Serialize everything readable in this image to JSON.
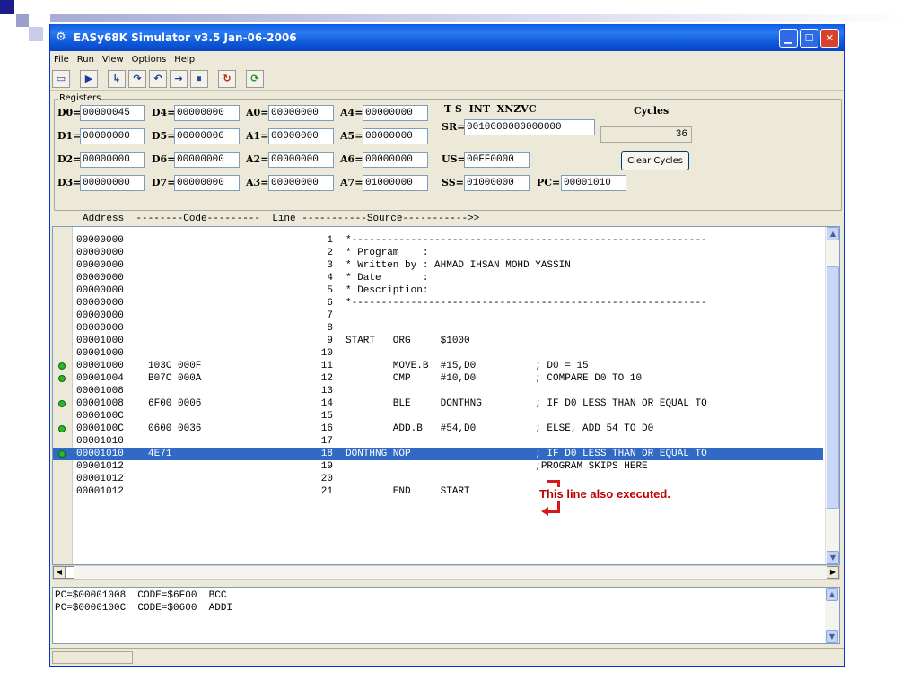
{
  "window": {
    "title": "EASy68K Simulator v3.5 Jan-06-2006"
  },
  "menu": [
    "File",
    "Run",
    "View",
    "Options",
    "Help"
  ],
  "registers": {
    "legend": "Registers",
    "D0": "00000045",
    "D1": "00000000",
    "D2": "00000000",
    "D3": "00000000",
    "D4": "00000000",
    "D5": "00000000",
    "D6": "00000000",
    "D7": "00000000",
    "A0": "00000000",
    "A1": "00000000",
    "A2": "00000000",
    "A3": "00000000",
    "A4": "00000000",
    "A5": "00000000",
    "A6": "00000000",
    "A7": "01000000",
    "status_header": "T S  INT  XNZVC",
    "SR": "0010000000000000",
    "US": "00FF0000",
    "SS": "01000000",
    "PC": "00001010",
    "cycles_label": "Cycles",
    "cycles": "36",
    "clear_cycles": "Clear Cycles"
  },
  "column_header": "Address  --------Code---------  Line -----------Source----------->>",
  "listing": [
    {
      "addr": "00000000",
      "code": "",
      "line": "1",
      "src": "*------------------------------------------------------------",
      "bp": false
    },
    {
      "addr": "00000000",
      "code": "",
      "line": "2",
      "src": "* Program    :",
      "bp": false
    },
    {
      "addr": "00000000",
      "code": "",
      "line": "3",
      "src": "* Written by : AHMAD IHSAN MOHD YASSIN",
      "bp": false
    },
    {
      "addr": "00000000",
      "code": "",
      "line": "4",
      "src": "* Date       :",
      "bp": false
    },
    {
      "addr": "00000000",
      "code": "",
      "line": "5",
      "src": "* Description:",
      "bp": false
    },
    {
      "addr": "00000000",
      "code": "",
      "line": "6",
      "src": "*------------------------------------------------------------",
      "bp": false
    },
    {
      "addr": "00000000",
      "code": "",
      "line": "7",
      "src": "",
      "bp": false
    },
    {
      "addr": "00000000",
      "code": "",
      "line": "8",
      "src": "",
      "bp": false
    },
    {
      "addr": "00001000",
      "code": "",
      "line": "9",
      "src": "START   ORG     $1000",
      "bp": false
    },
    {
      "addr": "00001000",
      "code": "",
      "line": "10",
      "src": "",
      "bp": false
    },
    {
      "addr": "00001000",
      "code": "103C 000F",
      "line": "11",
      "src": "        MOVE.B  #15,D0          ; D0 = 15",
      "bp": true
    },
    {
      "addr": "00001004",
      "code": "B07C 000A",
      "line": "12",
      "src": "        CMP     #10,D0          ; COMPARE D0 TO 10",
      "bp": true
    },
    {
      "addr": "00001008",
      "code": "",
      "line": "13",
      "src": "",
      "bp": false
    },
    {
      "addr": "00001008",
      "code": "6F00 0006",
      "line": "14",
      "src": "        BLE     DONTHNG         ; IF D0 LESS THAN OR EQUAL TO",
      "bp": true
    },
    {
      "addr": "0000100C",
      "code": "",
      "line": "15",
      "src": "",
      "bp": false
    },
    {
      "addr": "0000100C",
      "code": "0600 0036",
      "line": "16",
      "src": "        ADD.B   #54,D0          ; ELSE, ADD 54 TO D0",
      "bp": true
    },
    {
      "addr": "00001010",
      "code": "",
      "line": "17",
      "src": "",
      "bp": false
    },
    {
      "addr": "00001010",
      "code": "4E71",
      "line": "18",
      "src": "DONTHNG NOP                     ; IF D0 LESS THAN OR EQUAL TO",
      "bp": true,
      "selected": true
    },
    {
      "addr": "00001012",
      "code": "",
      "line": "19",
      "src": "                                ;PROGRAM SKIPS HERE",
      "bp": false
    },
    {
      "addr": "00001012",
      "code": "",
      "line": "20",
      "src": "",
      "bp": false
    },
    {
      "addr": "00001012",
      "code": "",
      "line": "21",
      "src": "        END     START",
      "bp": false
    }
  ],
  "output": [
    "PC=$00001008  CODE=$6F00  BCC",
    "PC=$0000100C  CODE=$0600  ADDI"
  ],
  "annotation": "This line also executed.",
  "colors": {
    "accent": "#316ac5",
    "breakpoint": "#2fb52f",
    "annotation": "#c00000"
  }
}
